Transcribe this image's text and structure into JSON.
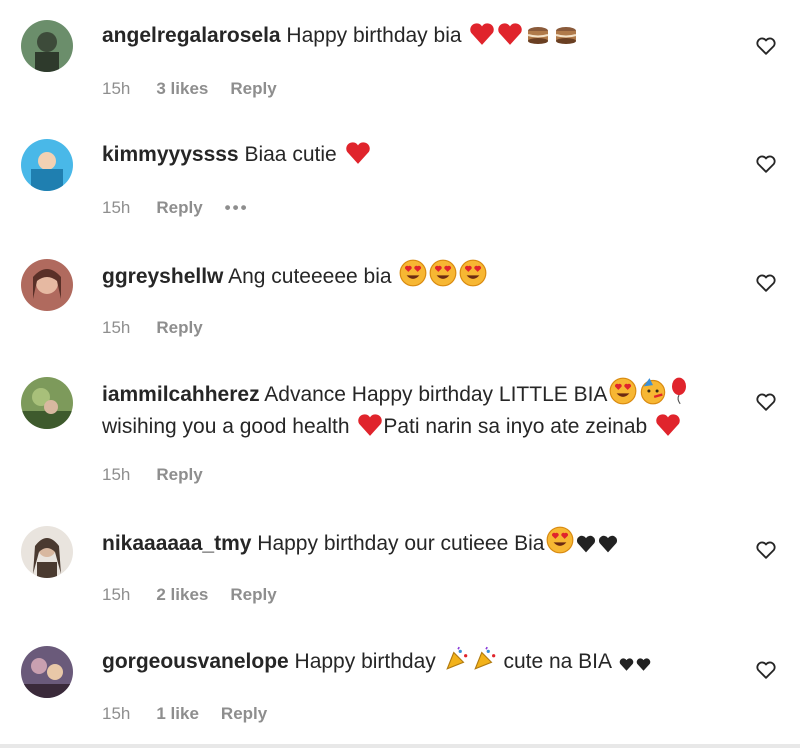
{
  "comments": [
    {
      "user": "angelregalarosela",
      "text": " Happy birthday bia",
      "emoji": [
        "red-heart",
        "red-heart",
        "cake",
        "cake"
      ],
      "time": "15h",
      "likes": "3 likes",
      "reply": "Reply",
      "colors": [
        "#6b8e6b",
        "#3d4b3a"
      ]
    },
    {
      "user": "kimmyyyssss",
      "text": " Biaa cutie",
      "emoji": [
        "red-heart"
      ],
      "time": "15h",
      "likes": "",
      "reply": "Reply",
      "more": "•••",
      "colors": [
        "#49b8e8",
        "#1f7fb0"
      ]
    },
    {
      "user": "ggreyshellw",
      "text": " Ang cuteeeee bia",
      "emoji": [
        "heart-eyes",
        "heart-eyes",
        "heart-eyes"
      ],
      "time": "15h",
      "likes": "",
      "reply": "Reply",
      "colors": [
        "#b06a5e",
        "#5a3028"
      ]
    },
    {
      "user": "iammilcahherez",
      "text": " Advance Happy birthday LITTLE BIA",
      "emoji": [
        "heart-eyes",
        "party-face",
        "balloon"
      ],
      "text2": "wisihing you a good health ",
      "text3": "Pati narin sa inyo ate zeinab ",
      "time": "15h",
      "likes": "",
      "reply": "Reply",
      "colors": [
        "#7d9a5b",
        "#3e5a2d"
      ]
    },
    {
      "user": "nikaaaaaa_tmy",
      "text": " Happy birthday our cutieee Bia",
      "emoji": [
        "heart-eyes",
        "black-heart",
        "black-heart"
      ],
      "time": "15h",
      "likes": "2 likes",
      "reply": "Reply",
      "colors": [
        "#d9cfc6",
        "#4a3a30"
      ]
    },
    {
      "user": "gorgeousvanelope",
      "text": " Happy birthday ",
      "emoji": [
        "party-popper",
        "party-popper"
      ],
      "text2": " cute na BIA ",
      "time": "15h",
      "likes": "1 like",
      "reply": "Reply",
      "colors": [
        "#6a5a7a",
        "#3a2a3a"
      ]
    }
  ]
}
